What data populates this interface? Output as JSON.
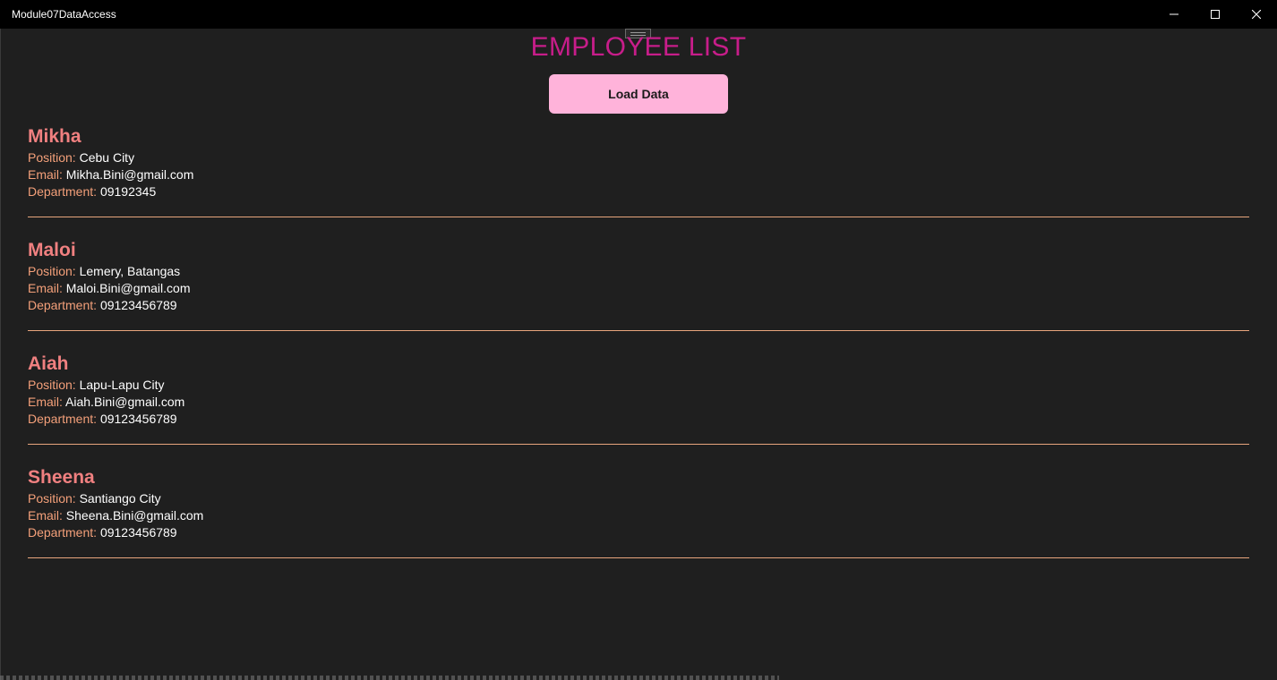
{
  "window": {
    "title": "Module07DataAccess",
    "controls": {
      "minimize_icon": "minimize-icon",
      "maximize_icon": "maximize-icon",
      "close_icon": "close-icon"
    }
  },
  "page": {
    "title": "EMPLOYEE LIST",
    "load_button_label": "Load Data"
  },
  "labels": {
    "position": "Position:",
    "email": "Email:",
    "department": "Department:"
  },
  "employees": [
    {
      "name": "Mikha",
      "position": "Cebu City",
      "email": "Mikha.Bini@gmail.com",
      "department": "09192345"
    },
    {
      "name": "Maloi",
      "position": "Lemery, Batangas",
      "email": "Maloi.Bini@gmail.com",
      "department": "09123456789"
    },
    {
      "name": "Aiah",
      "position": "Lapu-Lapu City",
      "email": "Aiah.Bini@gmail.com",
      "department": "09123456789"
    },
    {
      "name": "Sheena",
      "position": "Santiango City",
      "email": "Sheena.Bini@gmail.com",
      "department": "09123456789"
    }
  ],
  "colors": {
    "background": "#1f1f1f",
    "titlebar": "#000000",
    "title": "#c71d8a",
    "button": "#ffb3da",
    "name": "#f08080",
    "label": "#f4a07a",
    "divider": "#e8a57d"
  }
}
